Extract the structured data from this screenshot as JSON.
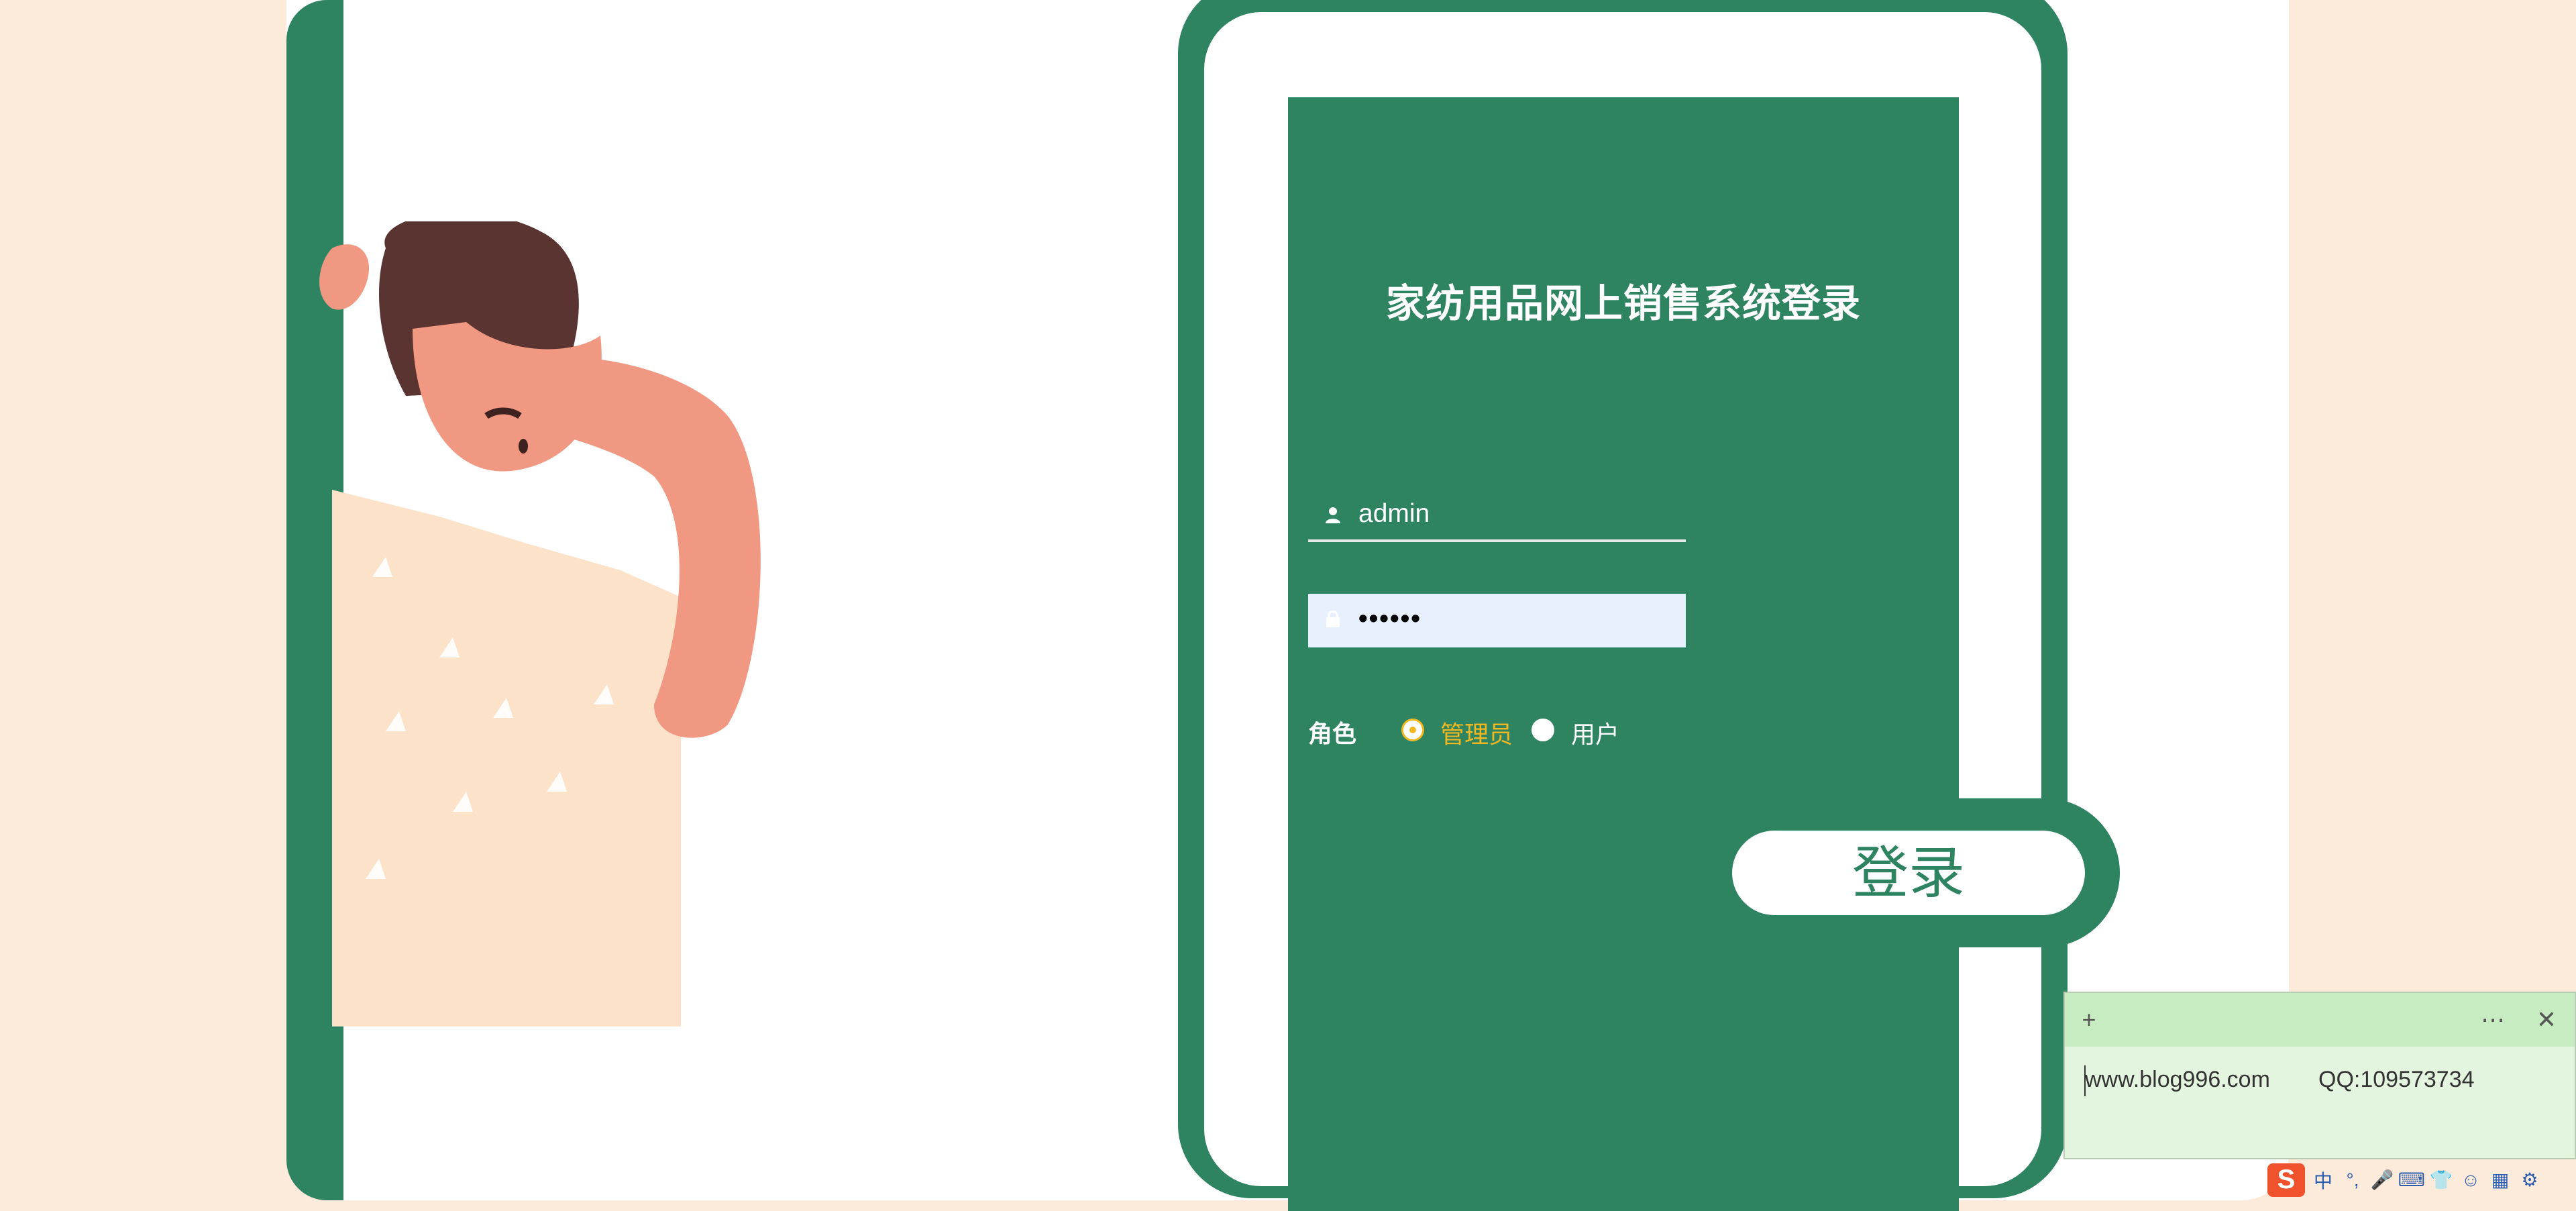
{
  "login": {
    "title": "家纺用品网上销售系统登录",
    "username_value": "admin",
    "password_mask": "••••••",
    "role_label": "角色",
    "roles": [
      "管理员",
      "用户"
    ],
    "selected_role": "管理员",
    "submit_label": "登录"
  },
  "sticky_note": {
    "line1": "www.blog996.com",
    "line2": "QQ:109573734"
  },
  "taskbar": {
    "ime_logo": "S",
    "ime_mode": "中"
  },
  "colors": {
    "brand_green": "#2e8360",
    "accent_yellow": "#f3b81f",
    "page_bg": "#fcebdb"
  }
}
